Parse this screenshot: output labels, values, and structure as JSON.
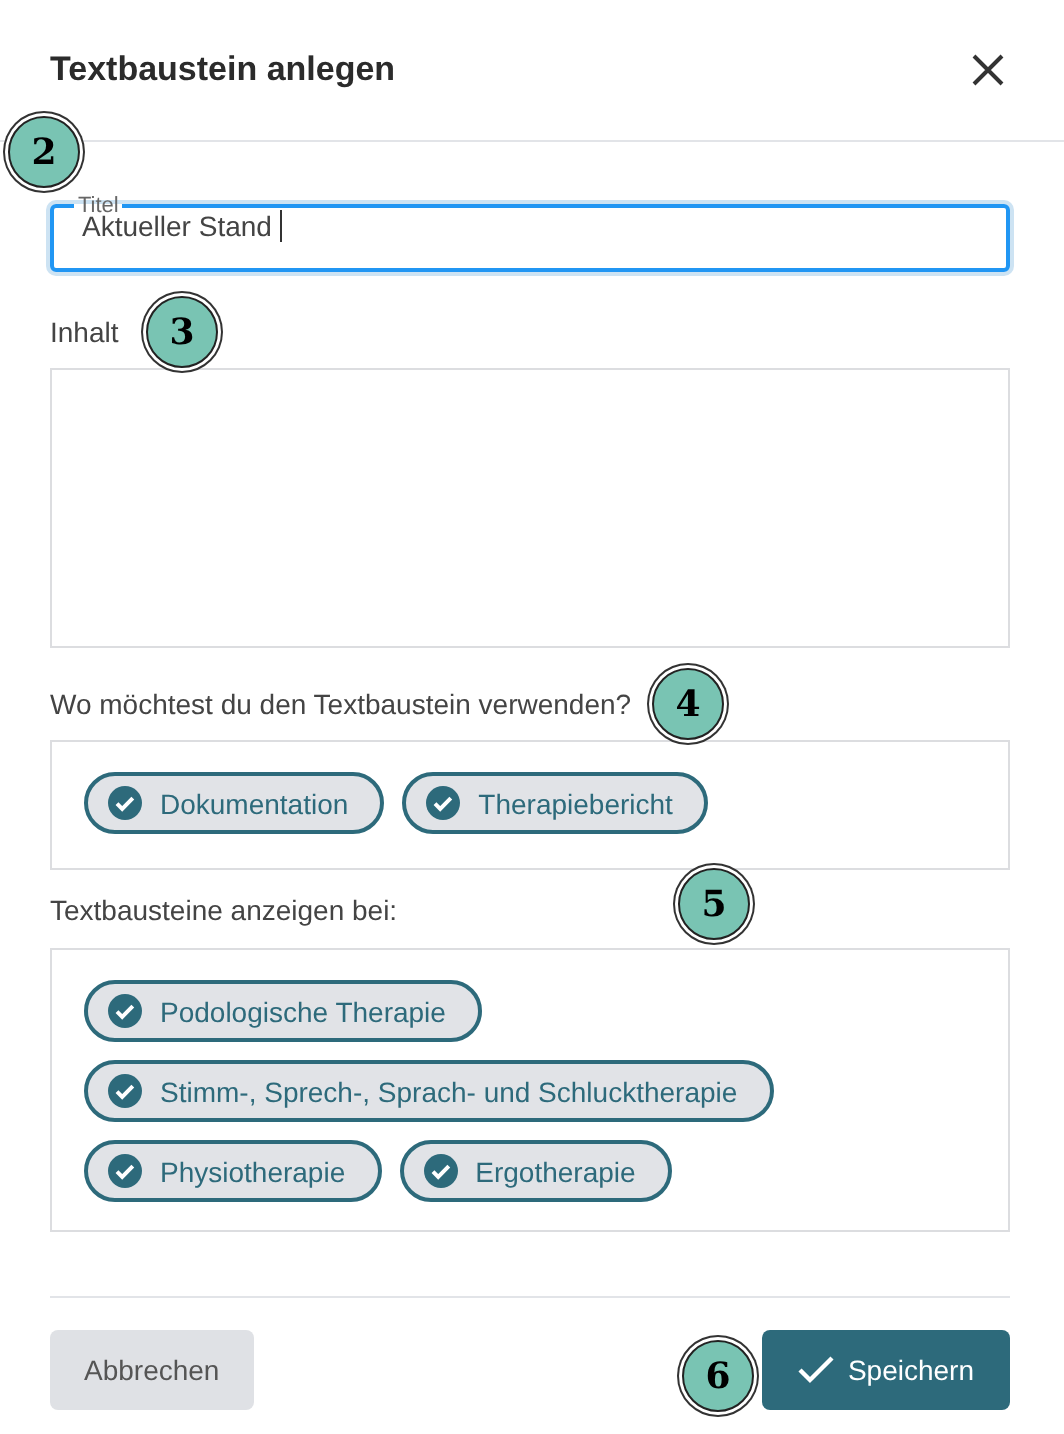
{
  "dialog": {
    "title": "Textbaustein anlegen"
  },
  "title_field": {
    "label": "Titel",
    "value": "Aktueller Stand"
  },
  "content_field": {
    "label": "Inhalt"
  },
  "usage": {
    "question": "Wo möchtest du den Textbaustein verwenden?",
    "chips": [
      {
        "label": "Dokumentation",
        "selected": true
      },
      {
        "label": "Therapiebericht",
        "selected": true
      }
    ]
  },
  "display": {
    "label": "Textbausteine anzeigen bei:",
    "chips": [
      {
        "label": "Podologische Therapie",
        "selected": true
      },
      {
        "label": "Stimm-, Sprech-, Sprach- und Schlucktherapie",
        "selected": true
      },
      {
        "label": "Physiotherapie",
        "selected": true
      },
      {
        "label": "Ergotherapie",
        "selected": true
      }
    ]
  },
  "buttons": {
    "cancel": "Abbrechen",
    "save": "Speichern"
  },
  "markers": [
    {
      "label": "2"
    },
    {
      "label": "3"
    },
    {
      "label": "4"
    },
    {
      "label": "5"
    },
    {
      "label": "6"
    }
  ]
}
